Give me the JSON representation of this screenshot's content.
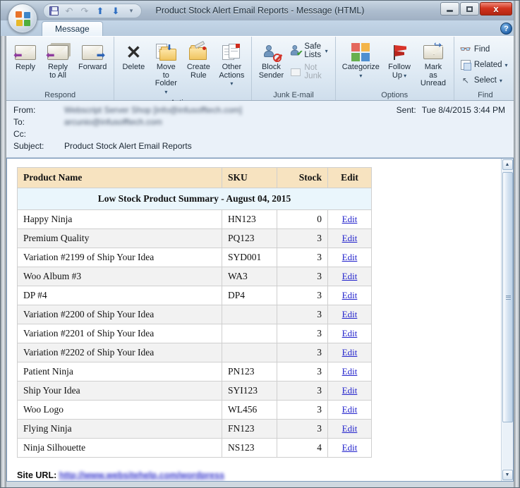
{
  "window": {
    "title": "Product Stock Alert Email Reports - Message (HTML)",
    "orb_name": "office-button",
    "minimize_label": "",
    "maximize_label": "",
    "close_label": "x",
    "help_label": "?"
  },
  "quick_access": [
    {
      "name": "save-button",
      "icon": "floppy-disk-icon",
      "glyph": ""
    },
    {
      "name": "undo-button",
      "icon": "undo-arrow-icon",
      "glyph": "↶"
    },
    {
      "name": "redo-button",
      "icon": "redo-arrow-icon",
      "glyph": "↷"
    },
    {
      "name": "previous-item-button",
      "icon": "blue-up-arrow-icon",
      "glyph": "⬆"
    },
    {
      "name": "next-item-button",
      "icon": "blue-down-arrow-icon",
      "glyph": "⬇"
    },
    {
      "name": "customize-qat-button",
      "icon": "chevron-down-icon",
      "glyph": "▾"
    }
  ],
  "tabs": [
    {
      "label": "Message",
      "active": true
    }
  ],
  "ribbon": {
    "groups": [
      {
        "label": "Respond",
        "dialog_launcher": false,
        "buttons": [
          {
            "label": "Reply",
            "label2": "",
            "icon": "envelope-reply-icon",
            "dropdown": false
          },
          {
            "label": "Reply",
            "label2": "to All",
            "icon": "envelope-reply-all-icon",
            "dropdown": false
          },
          {
            "label": "Forward",
            "label2": "",
            "icon": "envelope-forward-icon",
            "dropdown": false
          }
        ]
      },
      {
        "label": "Actions",
        "dialog_launcher": false,
        "buttons": [
          {
            "label": "Delete",
            "label2": "",
            "icon": "delete-x-icon",
            "dropdown": false
          },
          {
            "label": "Move to",
            "label2": "Folder",
            "icon": "move-to-folder-icon",
            "dropdown": true
          },
          {
            "label": "Create",
            "label2": "Rule",
            "icon": "create-rule-icon",
            "dropdown": false
          },
          {
            "label": "Other",
            "label2": "Actions",
            "icon": "other-actions-icon",
            "dropdown": true
          }
        ]
      },
      {
        "label": "Junk E-mail",
        "dialog_launcher": true,
        "buttons": [
          {
            "label": "Block",
            "label2": "Sender",
            "icon": "block-sender-icon",
            "dropdown": false
          }
        ],
        "small_buttons": [
          {
            "label": "Safe Lists",
            "icon": "safe-lists-icon",
            "dropdown": true,
            "disabled": false
          },
          {
            "label": "Not Junk",
            "icon": "not-junk-icon",
            "dropdown": false,
            "disabled": true
          }
        ]
      },
      {
        "label": "Options",
        "dialog_launcher": true,
        "buttons": [
          {
            "label": "Categorize",
            "label2": "",
            "icon": "categorize-icon",
            "dropdown": true
          },
          {
            "label": "Follow",
            "label2": "Up",
            "icon": "follow-up-flag-icon",
            "dropdown": true
          },
          {
            "label": "Mark as",
            "label2": "Unread",
            "icon": "mark-unread-envelope-icon",
            "dropdown": false
          }
        ]
      },
      {
        "label": "Find",
        "dialog_launcher": false,
        "buttons": [],
        "small_buttons": [
          {
            "label": "Find",
            "icon": "binoculars-icon",
            "dropdown": false,
            "disabled": false
          },
          {
            "label": "Related",
            "icon": "related-items-icon",
            "dropdown": true,
            "disabled": false
          },
          {
            "label": "Select",
            "icon": "select-cursor-icon",
            "dropdown": true,
            "disabled": false
          }
        ]
      }
    ]
  },
  "message": {
    "from_label": "From:",
    "from_value": "Webscript Server Shop [info@infusofftech.com]",
    "to_label": "To:",
    "to_value": "arcunio@infusofftech.com",
    "cc_label": "Cc:",
    "cc_value": "",
    "subject_label": "Subject:",
    "subject_value": "Product Stock Alert Email Reports",
    "sent_label": "Sent:",
    "sent_value": "Tue 8/4/2015 3:44 PM"
  },
  "report": {
    "title": "Low Stock Product Summary - August 04, 2015",
    "columns": [
      "Product Name",
      "SKU",
      "Stock",
      "Edit"
    ],
    "rows": [
      {
        "name": "Happy Ninja",
        "sku": "HN123",
        "stock": "0",
        "edit": "Edit"
      },
      {
        "name": "Premium Quality",
        "sku": "PQ123",
        "stock": "3",
        "edit": "Edit"
      },
      {
        "name": "Variation #2199 of Ship Your Idea",
        "sku": "SYD001",
        "stock": "3",
        "edit": "Edit"
      },
      {
        "name": "Woo Album #3",
        "sku": "WA3",
        "stock": "3",
        "edit": "Edit"
      },
      {
        "name": "DP #4",
        "sku": "DP4",
        "stock": "3",
        "edit": "Edit"
      },
      {
        "name": "Variation #2200 of Ship Your Idea",
        "sku": "",
        "stock": "3",
        "edit": "Edit"
      },
      {
        "name": "Variation #2201 of Ship Your Idea",
        "sku": "",
        "stock": "3",
        "edit": "Edit"
      },
      {
        "name": "Variation #2202 of Ship Your Idea",
        "sku": "",
        "stock": "3",
        "edit": "Edit"
      },
      {
        "name": "Patient Ninja",
        "sku": "PN123",
        "stock": "3",
        "edit": "Edit"
      },
      {
        "name": "Ship Your Idea",
        "sku": "SYI123",
        "stock": "3",
        "edit": "Edit"
      },
      {
        "name": "Woo Logo",
        "sku": "WL456",
        "stock": "3",
        "edit": "Edit"
      },
      {
        "name": "Flying Ninja",
        "sku": "FN123",
        "stock": "3",
        "edit": "Edit"
      },
      {
        "name": "Ninja Silhouette",
        "sku": "NS123",
        "stock": "4",
        "edit": "Edit"
      }
    ],
    "footer_label": "Site URL:",
    "footer_url": "http://www.websitehelp.com/wordpress"
  },
  "colors": {
    "title_row_bg": "#eaf6fc",
    "column_header_bg": "#f7e3c0",
    "row_alt_bg": "#f2f2f2",
    "link": "#2222cc",
    "close_button": "#d2341f"
  },
  "scrollbar": {
    "up_glyph": "▲",
    "down_glyph": "▼"
  }
}
